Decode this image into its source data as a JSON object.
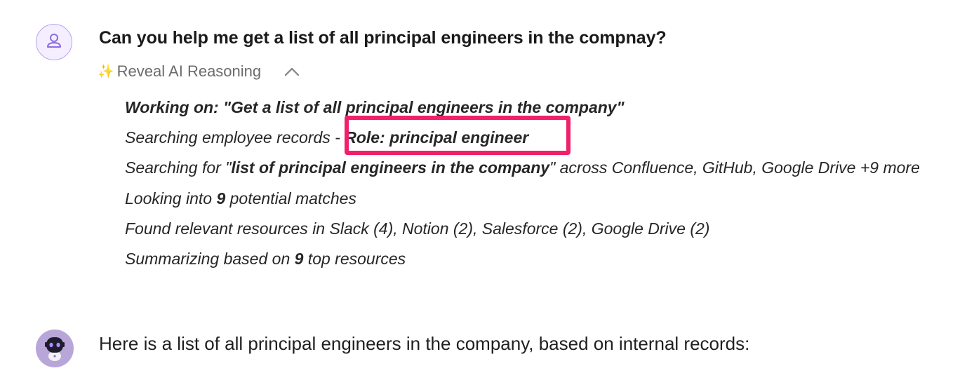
{
  "user_message": {
    "avatar_icon": "user-icon",
    "question": "Can you help me get a list of all principal engineers in the compnay?"
  },
  "reasoning_toggle": {
    "sparkle": "✨",
    "label": "Reveal AI Reasoning",
    "chevron_icon": "chevron-up-icon"
  },
  "reasoning": {
    "working_on_prefix": "Working on: \"Get a list of all principal engineers in the company\"",
    "line2_prefix": "Searching employee records - ",
    "line2_bold": "Role: principal engineer",
    "line3_prefix": "Searching for \"",
    "line3_bold": "list of principal engineers in the company",
    "line3_suffix": "\" across Confluence, GitHub, Google Drive +9 more",
    "line4_prefix": "Looking into ",
    "line4_bold": "9",
    "line4_suffix": " potential matches",
    "line5": "Found relevant resources in Slack (4), Notion (2), Salesforce (2), Google Drive (2)",
    "line6_prefix": "Summarizing based on ",
    "line6_bold": "9",
    "line6_suffix": " top resources"
  },
  "assistant_message": {
    "avatar_icon": "bot-avatar-icon",
    "answer": "Here is a list of all principal engineers in the company, based on internal records:"
  },
  "colors": {
    "highlight": "#f0206a",
    "user_avatar_bg": "#f4eeff",
    "user_avatar_icon": "#8a6ee0",
    "bot_avatar_bg": "#b8a6d9",
    "sparkle": "#f2c230"
  }
}
